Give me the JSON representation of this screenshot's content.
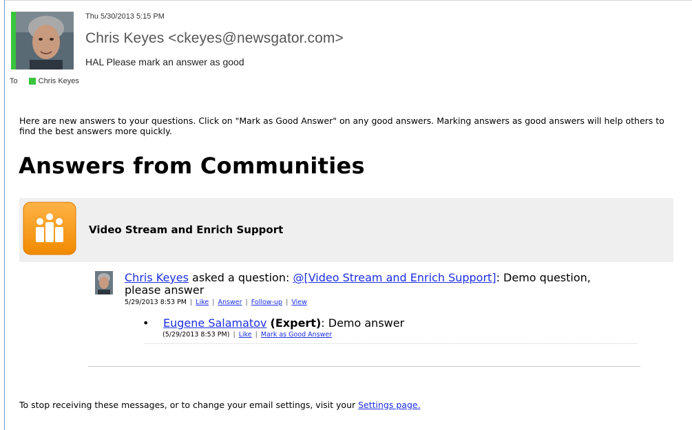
{
  "header": {
    "date": "Thu 5/30/2013 5:15 PM",
    "sender": "Chris Keyes <ckeyes@newsgator.com>",
    "subject": "HAL Please mark an answer as good",
    "to_label": "To",
    "recipient": "Chris Keyes"
  },
  "body": {
    "intro": "Here are new answers to your questions. Click on \"Mark as Good Answer\" on any good answers. Marking answers as good answers will help others to find the best answers more quickly.",
    "heading": "Answers from Communities",
    "community_name": "Video Stream and Enrich Support",
    "question": {
      "author": "Chris Keyes",
      "verb": " asked a question: ",
      "mention": "@[Video Stream and Enrich Support]",
      "text": ": Demo question, please answer",
      "timestamp": "5/29/2013 8:53 PM",
      "actions": [
        "Like",
        "Answer",
        "Follow-up",
        "View"
      ]
    },
    "answer": {
      "author": "Eugene Salamatov",
      "role": "(Expert)",
      "text": ":  Demo answer",
      "timestamp": "(5/29/2013 8:53 PM)",
      "actions": [
        "Like",
        "Mark as Good Answer"
      ]
    },
    "footer_text": "To stop receiving these messages, or to change your email settings, visit your ",
    "footer_link": "Settings page."
  },
  "colors": {
    "presence": "#39c53b",
    "link": "#1b2ee3",
    "community_band": "#efefef",
    "community_icon": "#f7931e"
  }
}
